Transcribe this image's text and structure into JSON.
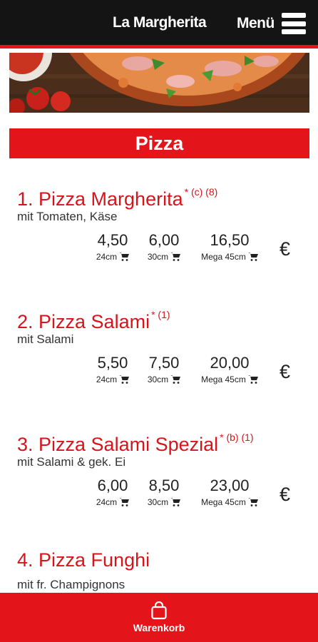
{
  "header": {
    "brand": "La Margherita",
    "menu_label": "Menü"
  },
  "section": {
    "title": "Pizza"
  },
  "items": [
    {
      "title": "1. Pizza Margherita",
      "footnotes": "* (c) (8)",
      "description": "mit Tomaten, Käse",
      "prices": [
        {
          "price": "4,50",
          "size": "24cm"
        },
        {
          "price": "6,00",
          "size": "30cm"
        },
        {
          "price": "16,50",
          "size": "Mega 45cm"
        }
      ],
      "currency": "€"
    },
    {
      "title": "2. Pizza Salami",
      "footnotes": "* (1)",
      "description": "mit Salami",
      "prices": [
        {
          "price": "5,50",
          "size": "24cm"
        },
        {
          "price": "7,50",
          "size": "30cm"
        },
        {
          "price": "20,00",
          "size": "Mega 45cm"
        }
      ],
      "currency": "€"
    },
    {
      "title": "3. Pizza Salami Spezial",
      "footnotes": "* (b) (1)",
      "description": "mit Salami & gek. Ei",
      "prices": [
        {
          "price": "6,00",
          "size": "24cm"
        },
        {
          "price": "8,50",
          "size": "30cm"
        },
        {
          "price": "23,00",
          "size": "Mega 45cm"
        }
      ],
      "currency": "€"
    },
    {
      "title": "4. Pizza Funghi",
      "footnotes": "",
      "description": "mit fr. Champignons"
    }
  ],
  "bottom_nav": {
    "cart_label": "Warenkorb"
  },
  "colors": {
    "accent": "#e3151b",
    "header_bg": "#141414",
    "title_red": "#d8141b"
  },
  "icons": {
    "menu": "hamburger-icon",
    "cart": "shopping-cart-icon",
    "bag": "shopping-bag-icon"
  }
}
